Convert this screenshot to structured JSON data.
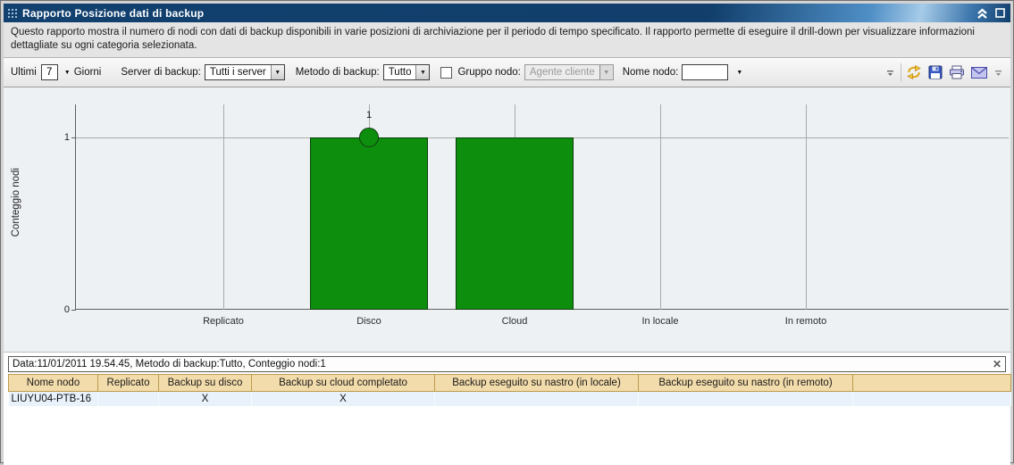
{
  "window": {
    "title": "Rapporto Posizione dati di backup"
  },
  "description": "Questo rapporto mostra il numero di nodi con dati di backup disponibili in varie posizioni di archiviazione per il periodo di tempo specificato. Il rapporto permette di eseguire il drill-down per visualizzare informazioni dettagliate su ogni categoria selezionata.",
  "toolbar": {
    "ultimi_label": "Ultimi",
    "days_value": "7",
    "giorni_label": "Giorni",
    "server_label": "Server di backup:",
    "server_value": "Tutti i server",
    "metodo_label": "Metodo di backup:",
    "metodo_value": "Tutto",
    "gruppo_label": "Gruppo nodo:",
    "gruppo_value": "Agente cliente",
    "nome_label": "Nome nodo:",
    "nome_value": "",
    "icon_names": [
      "refresh-icon",
      "save-icon",
      "print-icon",
      "email-icon"
    ]
  },
  "icons": {
    "dropdown": "▼",
    "close": "✕"
  },
  "chart_data": {
    "type": "bar",
    "title": "",
    "xlabel": "",
    "ylabel": "Conteggio nodi",
    "categories": [
      "Replicato",
      "Disco",
      "Cloud",
      "In locale",
      "In remoto"
    ],
    "values": [
      0,
      1,
      1,
      0,
      0
    ],
    "yticks": [
      0,
      1
    ],
    "ylim": [
      0,
      1.2
    ],
    "grid": true,
    "legend": false,
    "bar_color": "#0d8e0d",
    "marker": {
      "category": "Disco",
      "value": 1,
      "label": "1"
    }
  },
  "details": {
    "info": "Data:11/01/2011 19.54.45, Metodo di backup:Tutto, Conteggio nodi:1",
    "columns": [
      "Nome nodo",
      "Replicato",
      "Backup su disco",
      "Backup su cloud completato",
      "Backup eseguito su nastro (in locale)",
      "Backup eseguito su nastro (in remoto)",
      ""
    ],
    "rows": [
      [
        "LIUYU04-PTB-16",
        "",
        "X",
        "X",
        "",
        "",
        ""
      ]
    ]
  }
}
